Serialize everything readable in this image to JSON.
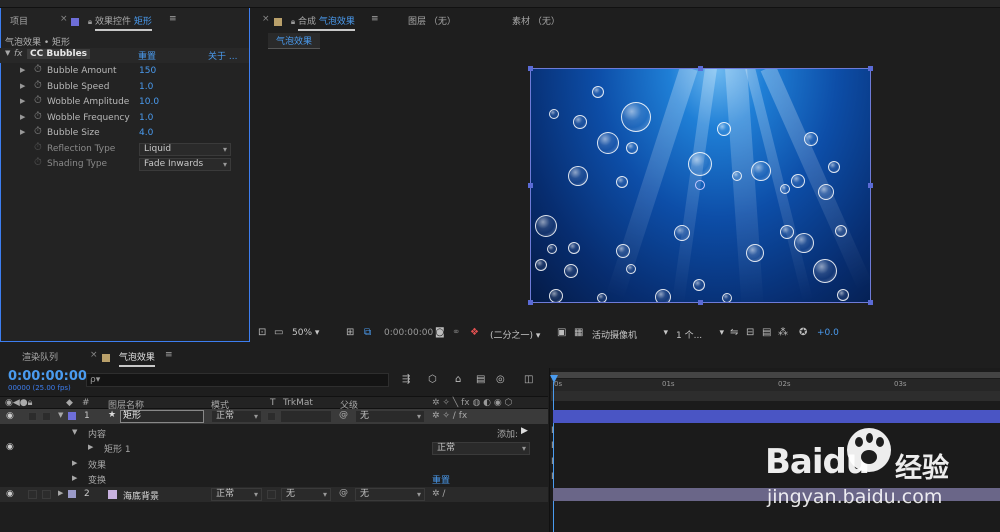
{
  "effect_controls": {
    "tab_project": "项目",
    "tab_prefix": "效果控件",
    "tab_layer": "矩形",
    "breadcrumb": "气泡效果 • 矩形",
    "fx_label": "fx",
    "effect_name": "CC Bubbles",
    "reset": "重置",
    "about": "关于 ...",
    "properties": [
      {
        "label": "Bubble Amount",
        "value": "150"
      },
      {
        "label": "Bubble Speed",
        "value": "1.0"
      },
      {
        "label": "Wobble Amplitude",
        "value": "10.0"
      },
      {
        "label": "Wobble Frequency",
        "value": "1.0"
      },
      {
        "label": "Bubble Size",
        "value": "4.0"
      }
    ],
    "dropdowns": [
      {
        "label": "Reflection Type",
        "value": "Liquid"
      },
      {
        "label": "Shading Type",
        "value": "Fade Inwards"
      }
    ]
  },
  "composition": {
    "tab_prefix": "合成",
    "tab_name": "气泡效果",
    "layer_tab": "图层 （无）",
    "footage_tab": "素材 （无）",
    "sub_tab": "气泡效果",
    "zoom": "50%",
    "timecode": "0:00:00:00",
    "resolution": "(二分之一)",
    "camera": "活动摄像机",
    "views": "1 个...",
    "exposure": "+0.0"
  },
  "timeline": {
    "tab_render_queue": "渲染队列",
    "tab_comp": "气泡效果",
    "timecode": "0:00:00:00",
    "frame_info": "00000 (25.00 fps)",
    "search_placeholder": "ρ▾",
    "col_num": "#",
    "col_layer_name": "图层名称",
    "col_mode": "模式",
    "col_t": "T",
    "col_trkmat": "TrkMat",
    "col_parent": "父级",
    "ruler": [
      "0s",
      "01s",
      "02s",
      "03s"
    ],
    "layers": [
      {
        "num": "1",
        "name": "矩形",
        "mode": "正常",
        "trkmat": "",
        "parent": "无"
      },
      {
        "num": "2",
        "name": "海底背景",
        "mode": "正常",
        "trkmat": "无",
        "parent": "无"
      }
    ],
    "contents": "内容",
    "add_label": "添加:",
    "shape": "矩形 1",
    "shape_mode": "正常",
    "effects": "效果",
    "transform": "变换",
    "transform_reset": "重置"
  },
  "watermark": {
    "brand": "Baidu",
    "suffix": "经验",
    "url": "jingyan.baidu.com"
  },
  "colors": {
    "accent_blue": "#4a9bef",
    "layer_bar_1": "#4a55c4",
    "layer_bar_2": "#6a6688",
    "label_purple": "#6e6ed8",
    "label_lavender": "#9a9ac8"
  }
}
